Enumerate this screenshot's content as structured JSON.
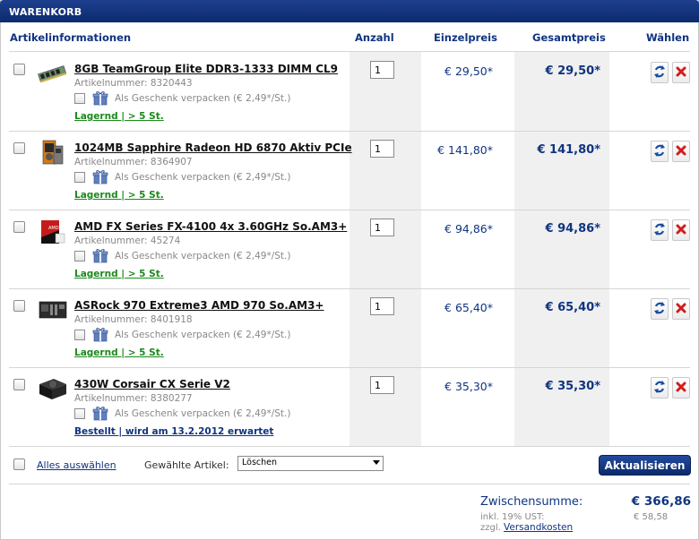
{
  "panel": {
    "title": "WARENKORB"
  },
  "headers": {
    "article": "Artikelinformationen",
    "qty": "Anzahl",
    "unit": "Einzelpreis",
    "total": "Gesamtpreis",
    "choose": "Wählen"
  },
  "items": [
    {
      "name": "8GB TeamGroup Elite DDR3-1333 DIMM CL9",
      "partno": "Artikelnummer: 8320443",
      "gift": "Als Geschenk verpacken (€ 2,49*/St.)",
      "stock": "Lagernd | > 5 St.",
      "qty": "1",
      "unit": "€ 29,50*",
      "total": "€ 29,50*",
      "icon": "ram-module-icon"
    },
    {
      "name": "1024MB Sapphire Radeon HD 6870 Aktiv PCIe",
      "partno": "Artikelnummer: 8364907",
      "gift": "Als Geschenk verpacken (€ 2,49*/St.)",
      "stock": "Lagernd | > 5 St.",
      "qty": "1",
      "unit": "€ 141,80*",
      "total": "€ 141,80*",
      "icon": "graphics-card-icon"
    },
    {
      "name": "AMD FX Series FX-4100 4x 3.60GHz So.AM3+",
      "partno": "Artikelnummer: 45274",
      "gift": "Als Geschenk verpacken (€ 2,49*/St.)",
      "stock": "Lagernd | > 5 St.",
      "qty": "1",
      "unit": "€ 94,86*",
      "total": "€ 94,86*",
      "icon": "cpu-box-icon"
    },
    {
      "name": "ASRock 970 Extreme3 AMD 970 So.AM3+",
      "partno": "Artikelnummer: 8401918",
      "gift": "Als Geschenk verpacken (€ 2,49*/St.)",
      "stock": "Lagernd | > 5 St.",
      "qty": "1",
      "unit": "€ 65,40*",
      "total": "€ 65,40*",
      "icon": "motherboard-icon"
    },
    {
      "name": "430W Corsair CX Serie V2",
      "partno": "Artikelnummer: 8380277",
      "gift": "Als Geschenk verpacken (€ 2,49*/St.)",
      "stock": "Bestellt | wird am 13.2.2012 erwartet",
      "qty": "1",
      "unit": "€ 35,30*",
      "total": "€ 35,30*",
      "icon": "power-supply-icon"
    }
  ],
  "colors": {
    "in_stock": "#1b8a1b",
    "ordered": "#0f3480",
    "accent": "#0f3480"
  },
  "footer": {
    "select_all": "Alles auswählen",
    "selected_label": "Gewählte Artikel:",
    "action_value": "Löschen",
    "update_button": "Aktualisieren"
  },
  "summary": {
    "subtotal_label": "Zwischensumme:",
    "subtotal_value": "€ 366,86",
    "vat_label": "inkl. 19% UST:",
    "vat_value": "€ 58,58",
    "shipping_prefix": "zzgl.",
    "shipping_link": "Versandkosten"
  }
}
